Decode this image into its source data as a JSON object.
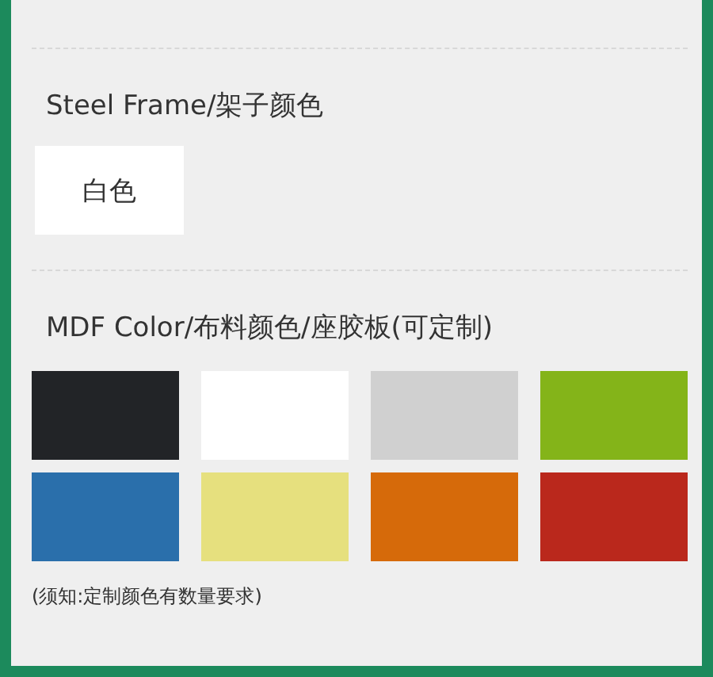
{
  "frame_section": {
    "title": "Steel Frame/架子颜色",
    "options": [
      {
        "label": "白色"
      }
    ]
  },
  "color_section": {
    "title": "MDF Color/布料颜色/座胶板(可定制)",
    "swatches": [
      {
        "color": "#222427"
      },
      {
        "color": "#ffffff"
      },
      {
        "color": "#d0d0d0"
      },
      {
        "color": "#84b419"
      },
      {
        "color": "#2a6fab"
      },
      {
        "color": "#e6e07e"
      },
      {
        "color": "#d66a0a"
      },
      {
        "color": "#ba281c"
      }
    ],
    "note": "(须知:定制颜色有数量要求)"
  }
}
